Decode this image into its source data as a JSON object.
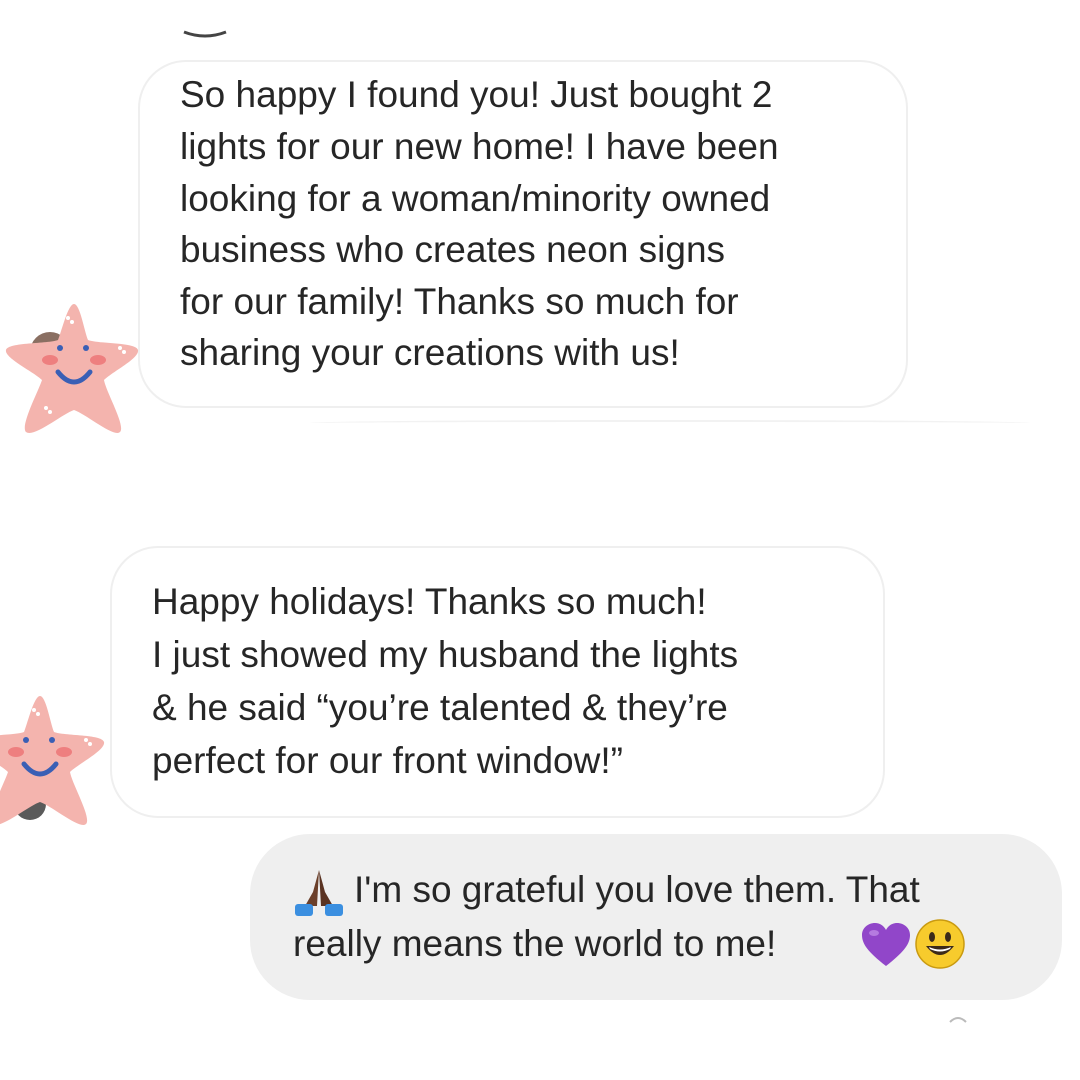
{
  "messages": [
    {
      "sender": "them",
      "lines": [
        "So happy I found you! Just bought 2",
        "lights for our new home! I have been",
        "looking for a woman/minority owned",
        "business who creates neon signs",
        "for our family! Thanks so much for",
        "sharing your creations with us!"
      ]
    },
    {
      "sender": "them",
      "lines": [
        "Happy holidays! Thanks so much!",
        "I just showed my husband the lights",
        "& he said “you’re talented & they’re",
        "perfect for our front window!”"
      ]
    },
    {
      "sender": "me",
      "lines": [
        "I'm so grateful you love them. That",
        "really means the world to me!"
      ],
      "leading_emoji": "praying-hands-icon",
      "trailing_emojis": [
        "purple-heart-icon",
        "smiley-face-icon"
      ]
    }
  ],
  "avatar_sticker": "starfish-sticker-icon",
  "colors": {
    "incoming_bubble_bg": "#ffffff",
    "incoming_bubble_border": "#efefef",
    "outgoing_bubble_bg": "#efefef",
    "text": "#262626",
    "starfish": "#f4b4ae",
    "purple_heart": "#9146c9",
    "smiley": "#f7cb2d"
  }
}
